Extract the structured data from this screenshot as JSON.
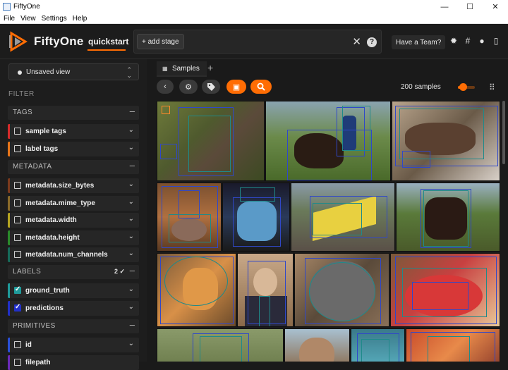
{
  "window": {
    "title": "FiftyOne",
    "minimize": "—",
    "maximize": "☐",
    "close": "✕"
  },
  "menubar": [
    "File",
    "View",
    "Settings",
    "Help"
  ],
  "header": {
    "brand": "FiftyOne",
    "dataset": "quickstart",
    "add_stage": "+ add stage",
    "clear": "✕",
    "help": "?",
    "team_button": "Have a Team?",
    "icons": [
      "sun-icon",
      "slack-icon",
      "github-icon",
      "docs-icon"
    ]
  },
  "sidebar": {
    "view_select": "Unsaved view",
    "filter_label": "FILTER",
    "groups": {
      "tags": "TAGS",
      "metadata": "METADATA",
      "labels": "LABELS",
      "labels_count": "2 ✓",
      "primitives": "PRIMITIVES"
    },
    "tags_items": [
      {
        "label": "sample tags",
        "color": "#d62b2b"
      },
      {
        "label": "label tags",
        "color": "#e8761a"
      }
    ],
    "metadata_items": [
      {
        "label": "metadata.size_bytes",
        "color": "#7b3a1d"
      },
      {
        "label": "metadata.mime_type",
        "color": "#8a6b2a"
      },
      {
        "label": "metadata.width",
        "color": "#b5a421"
      },
      {
        "label": "metadata.height",
        "color": "#2a8a2a"
      },
      {
        "label": "metadata.num_channels",
        "color": "#166b5a"
      }
    ],
    "labels_items": [
      {
        "label": "ground_truth",
        "color": "#1f9a9a",
        "checked": true
      },
      {
        "label": "predictions",
        "color": "#2230c8",
        "checked": true
      }
    ],
    "primitives_items": [
      {
        "label": "id",
        "color": "#2a50d8"
      },
      {
        "label": "filepath",
        "color": "#6a2ab8"
      }
    ]
  },
  "main": {
    "tab_label": "Samples",
    "tab_add": "+",
    "toolbar": {
      "back": "‹",
      "settings": "⚙",
      "tag": "🏷",
      "select": "▣",
      "search": "⌕"
    },
    "sample_count": "200 samples",
    "zoom_level": 0.3
  }
}
